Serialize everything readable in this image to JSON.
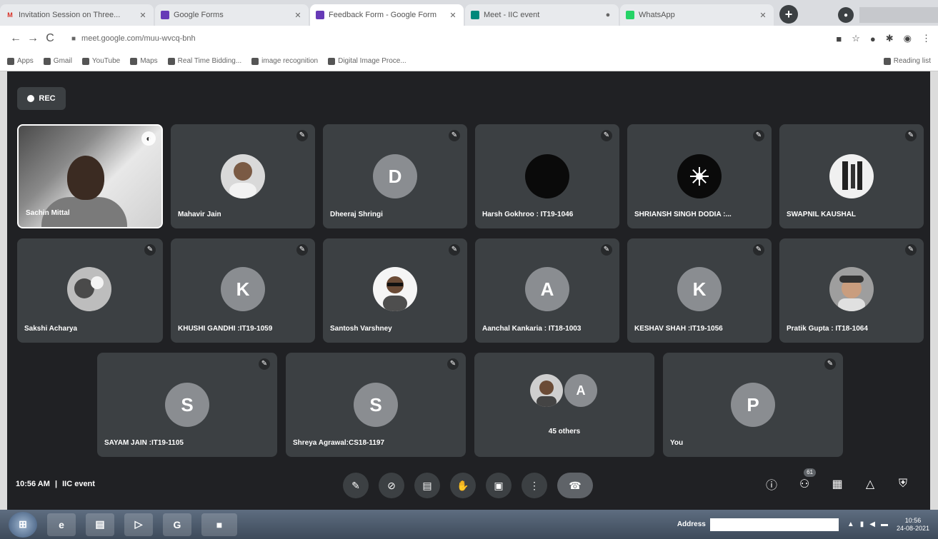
{
  "browser": {
    "tabs": [
      {
        "title": "Invitation Session on Three...",
        "favicon": "gmail-icon",
        "active": false
      },
      {
        "title": "Google Forms",
        "favicon": "forms-icon",
        "active": false
      },
      {
        "title": "Feedback Form - Google Form",
        "favicon": "forms-icon",
        "active": true
      },
      {
        "title": "Meet - IIC event",
        "favicon": "meet-icon",
        "active": false
      },
      {
        "title": "WhatsApp",
        "favicon": "whatsapp-icon",
        "active": false
      }
    ],
    "new_tab_label": "+",
    "url": "meet.google.com/muu-wvcq-bnh",
    "bookmarks": [
      "Apps",
      "Gmail",
      "YouTube",
      "Maps",
      "Real Time Bidding...",
      "image recognition",
      "Digital Image Proce..."
    ],
    "reading_list": "Reading list"
  },
  "meet": {
    "rec_label": "REC",
    "participants": [
      {
        "name": "Sachin Mittal",
        "kind": "video"
      },
      {
        "name": "Mahavir Jain",
        "kind": "photo"
      },
      {
        "name": "Dheeraj Shringi",
        "kind": "letter",
        "initial": "D"
      },
      {
        "name": "Harsh Gokhroo : IT19-1046",
        "kind": "black"
      },
      {
        "name": "SHRIANSH SINGH DODIA :...",
        "kind": "black"
      },
      {
        "name": "SWAPNIL KAUSHAL",
        "kind": "photo"
      },
      {
        "name": "Sakshi Acharya",
        "kind": "photo"
      },
      {
        "name": "KHUSHI GANDHI :IT19-1059",
        "kind": "letter",
        "initial": "K"
      },
      {
        "name": "Santosh Varshney",
        "kind": "photo"
      },
      {
        "name": "Aanchal Kankaria : IT18-1003",
        "kind": "letter",
        "initial": "A"
      },
      {
        "name": "KESHAV SHAH :IT19-1056",
        "kind": "letter",
        "initial": "K"
      },
      {
        "name": "Pratik Gupta : IT18-1064",
        "kind": "photo"
      },
      {
        "name": "SAYAM JAIN :IT19-1105",
        "kind": "letter",
        "initial": "S"
      },
      {
        "name": "Shreya Agrawal:CS18-1197",
        "kind": "letter",
        "initial": "S"
      },
      {
        "name": "45 others",
        "kind": "others",
        "initial": "A"
      },
      {
        "name": "You",
        "kind": "letter",
        "initial": "P"
      }
    ],
    "time": "10:56 AM",
    "separator": "|",
    "meeting_name": "IIC event",
    "participant_count_badge": "61"
  },
  "taskbar": {
    "address_label": "Address",
    "clock_time": "10:56",
    "clock_date": "24-08-2021"
  }
}
